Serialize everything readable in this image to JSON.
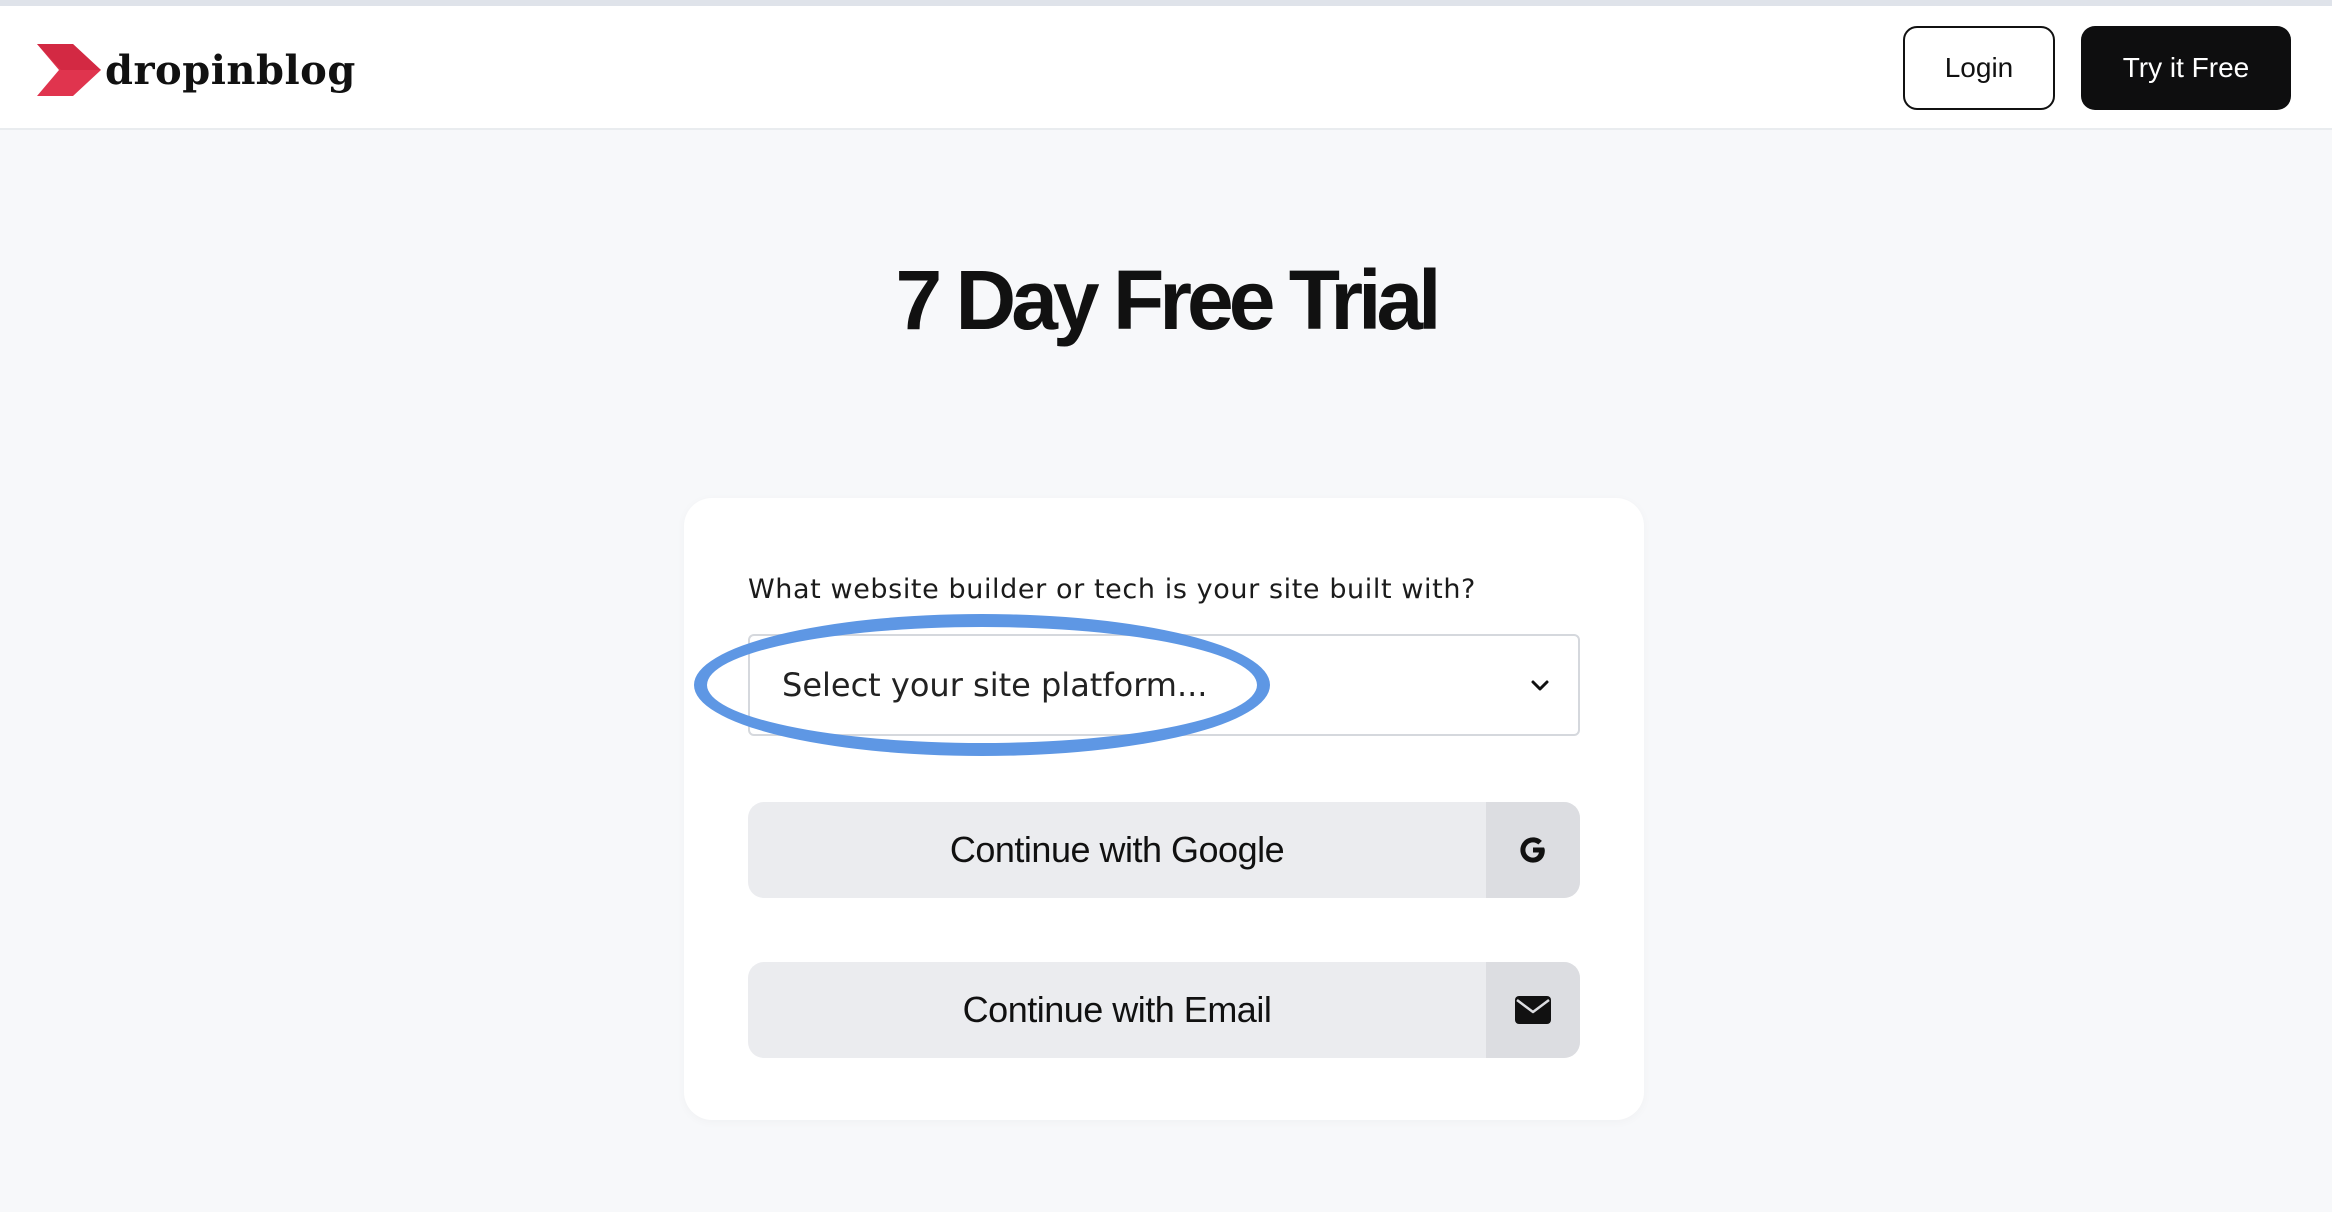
{
  "header": {
    "logo_text": "dropinblog",
    "login_label": "Login",
    "try_label": "Try it Free"
  },
  "main": {
    "title": "7 Day Free Trial",
    "form": {
      "platform_question": "What website builder or tech is your site built with?",
      "platform_select": {
        "value": "Select your site platform..."
      },
      "google_button": "Continue with Google",
      "email_button": "Continue with Email"
    }
  },
  "colors": {
    "logo_red": "#e0344e",
    "highlight_blue": "#5e97e4",
    "primary_dark": "#0e0e0f"
  },
  "icons": {
    "logo": "dropinblog-arrow-logo",
    "select": "chevron-down-icon",
    "google": "google-g-icon",
    "email": "envelope-icon"
  }
}
